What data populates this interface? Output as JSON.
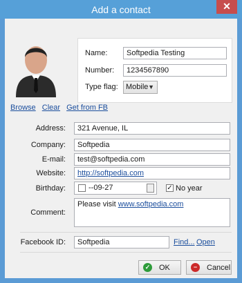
{
  "window": {
    "title": "Add a contact",
    "close_glyph": "✕"
  },
  "contact": {
    "name_label": "Name:",
    "name_value": "Softpedia Testing",
    "number_label": "Number:",
    "number_value": "1234567890",
    "type_flag_label": "Type flag:",
    "type_flag_value": "Mobile"
  },
  "photo_links": {
    "browse": "Browse",
    "clear": "Clear",
    "get_from_fb": "Get from FB"
  },
  "fields": {
    "address_label": "Address:",
    "address_value": "321 Avenue, IL",
    "company_label": "Company:",
    "company_value": "Softpedia",
    "email_label": "E-mail:",
    "email_value": "test@softpedia.com",
    "website_label": "Website:",
    "website_value": "http://softpedia.com",
    "birthday_label": "Birthday:",
    "birthday_value": "--09-27",
    "no_year_label": "No year",
    "comment_label": "Comment:",
    "comment_prefix": "Please visit ",
    "comment_link": "www.softpedia.com"
  },
  "facebook": {
    "label": "Facebook ID:",
    "value": "Softpedia",
    "find_label": "Find...",
    "open_label": "Open"
  },
  "buttons": {
    "ok_label": "OK",
    "cancel_label": "Cancel"
  },
  "colors": {
    "accent": "#56a0d8",
    "link": "#1a4d9c",
    "ok_icon": "#2e9b3a",
    "cancel_icon": "#cc2a2a"
  }
}
